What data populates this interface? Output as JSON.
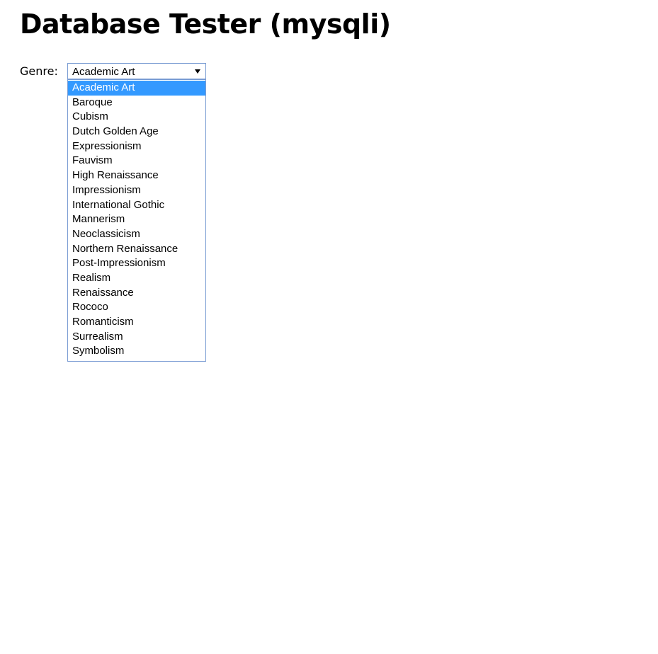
{
  "page": {
    "title": "Database Tester (mysqli)"
  },
  "form": {
    "genre_label": "Genre:",
    "genre_select": {
      "selected_value": "Academic Art",
      "highlighted_index": 0,
      "options": [
        "Academic Art",
        "Baroque",
        "Cubism",
        "Dutch Golden Age",
        "Expressionism",
        "Fauvism",
        "High Renaissance",
        "Impressionism",
        "International Gothic",
        "Mannerism",
        "Neoclassicism",
        "Northern Renaissance",
        "Post-Impressionism",
        "Realism",
        "Renaissance",
        "Rococo",
        "Romanticism",
        "Surrealism",
        "Symbolism"
      ],
      "arrow_icon": "chevron-down-icon"
    }
  },
  "colors": {
    "highlight_background": "#3399ff",
    "highlight_text": "#ffffff",
    "select_border": "#7a9cd3"
  }
}
